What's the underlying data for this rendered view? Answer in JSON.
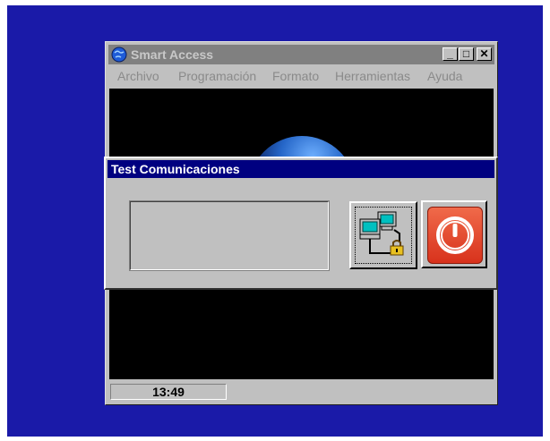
{
  "window": {
    "title": "Smart Access",
    "minimize": "_",
    "maximize": "□",
    "close": "✕"
  },
  "menu": [
    "Archivo",
    "Programación",
    "Formato",
    "Herramientas",
    "Ayuda"
  ],
  "status": {
    "time": "13:49"
  },
  "dialog": {
    "title": "Test Comunicaciones"
  },
  "icons": {
    "app": "globe-icon",
    "network": "network-computers-icon",
    "power": "power-icon"
  },
  "colors": {
    "desktop": "#1a1aa8",
    "dialog_titlebar": "#000080",
    "power_button": "#e04a2c"
  }
}
